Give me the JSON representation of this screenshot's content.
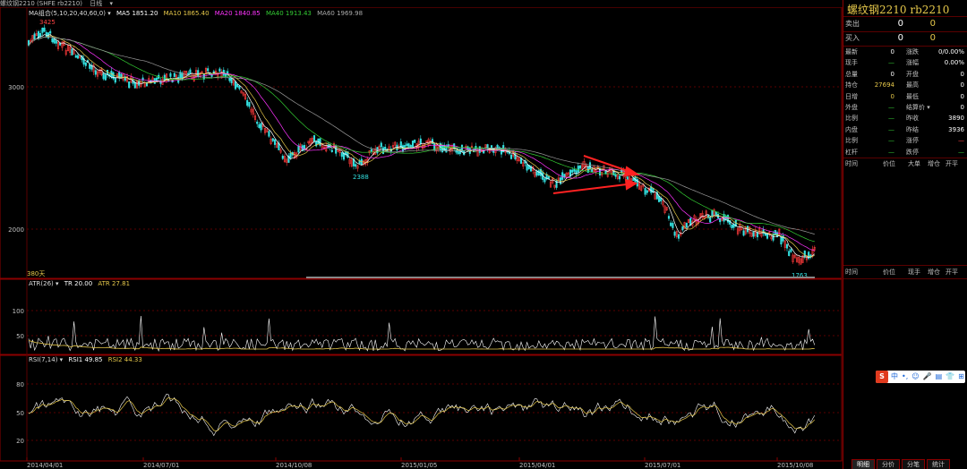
{
  "header": {
    "icon_label": "螺纹钢2210 (SHFE rb2210)",
    "period": "日线",
    "name": "螺纹钢2210",
    "code": "rb2210"
  },
  "main_panel": {
    "legend_name": "MA组合(5,10,20,40,60,0)",
    "ma5": "MA5 1851.20",
    "ma10": "MA10 1865.40",
    "ma20": "MA20 1840.85",
    "ma40": "MA40 1913.43",
    "ma60": "MA60 1969.98",
    "high_mark": "3425",
    "mid_low_mark": "2388",
    "low_mark": "1763",
    "days_label": "380天",
    "y_ticks": [
      "3000",
      "2000"
    ]
  },
  "atr_panel": {
    "name": "ATR(26)",
    "tr": "TR 20.00",
    "atr": "ATR 27.81",
    "y_ticks": [
      "100",
      "50"
    ]
  },
  "rsi_panel": {
    "name": "RSI(7,14)",
    "rsi1": "RSI1 49.85",
    "rsi2": "RSI2 44.33",
    "y_ticks": [
      "80",
      "50",
      "20"
    ]
  },
  "x_axis": [
    "2014/04/01",
    "2014/07/01",
    "2014/10/08",
    "2015/01/05",
    "2015/04/01",
    "2015/07/01",
    "2015/10/08"
  ],
  "quote": {
    "sell_label": "卖出",
    "sell_price": "0",
    "sell_vol": "0",
    "buy_label": "买入",
    "buy_price": "0",
    "buy_vol": "0",
    "rows": [
      {
        "l1": "最新",
        "v1": "0",
        "l2": "涨跌",
        "v2": "0/0.00%"
      },
      {
        "l1": "现手",
        "v1": "—",
        "l2": "涨幅",
        "v2": "0.00%"
      },
      {
        "l1": "总量",
        "v1": "0",
        "l2": "开盘",
        "v2": "0"
      },
      {
        "l1": "持仓",
        "v1": "27694",
        "l2": "最高",
        "v2": "0"
      },
      {
        "l1": "日增",
        "v1": "0",
        "l2": "最低",
        "v2": "0"
      },
      {
        "l1": "外盘",
        "v1": "—",
        "l2": "结算价",
        "v2": "0"
      },
      {
        "l1": "比例",
        "v1": "—",
        "l2": "昨收",
        "v2": "3890"
      },
      {
        "l1": "内盘",
        "v1": "—",
        "l2": "昨结",
        "v2": "3936"
      },
      {
        "l1": "比例",
        "v1": "—",
        "l2": "涨停",
        "v2": "—"
      },
      {
        "l1": "杠杆",
        "v1": "—",
        "l2": "跌停",
        "v2": "—"
      }
    ],
    "tick_headers": [
      "时间",
      "价位",
      "大单",
      "增仓",
      "开平"
    ],
    "trade_headers": [
      "时间",
      "价位",
      "现手",
      "增仓",
      "开平"
    ]
  },
  "tabs": [
    "明细",
    "分价",
    "分笔",
    "统计"
  ],
  "ime": {
    "items": [
      "中",
      "•,",
      "☺",
      "🎤",
      "▤",
      "👕",
      "⊞"
    ]
  },
  "colors": {
    "up": "#ff3b3b",
    "down": "#33e0e0",
    "ma5": "#ffffff",
    "ma10": "#e6c84a",
    "ma20": "#ff33ff",
    "ma40": "#33cc33",
    "ma60": "#999999",
    "grid": "#7a0000"
  }
}
